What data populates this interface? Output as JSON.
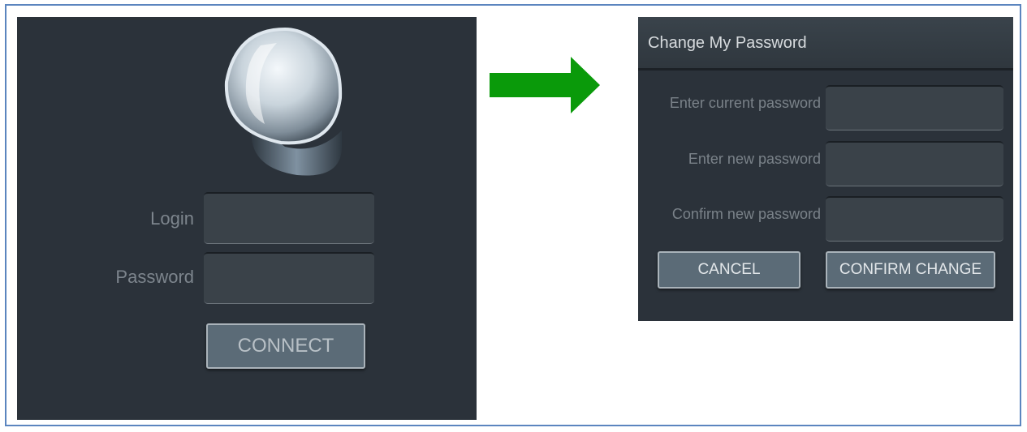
{
  "login": {
    "login_label": "Login",
    "password_label": "Password",
    "connect_label": "CONNECT"
  },
  "dialog": {
    "title": "Change My Password",
    "current_label": "Enter current password",
    "new_label": "Enter new password",
    "confirm_label": "Confirm new password",
    "cancel_label": "CANCEL",
    "confirm_change_label": "CONFIRM CHANGE"
  },
  "colors": {
    "panel_bg": "#2b323a",
    "arrow": "#0a9a0a",
    "frame_border": "#5b85bf",
    "button_bg": "#5b6b77"
  },
  "icons": {
    "logo": "droplet-logo-icon",
    "arrow": "right-arrow-icon"
  }
}
